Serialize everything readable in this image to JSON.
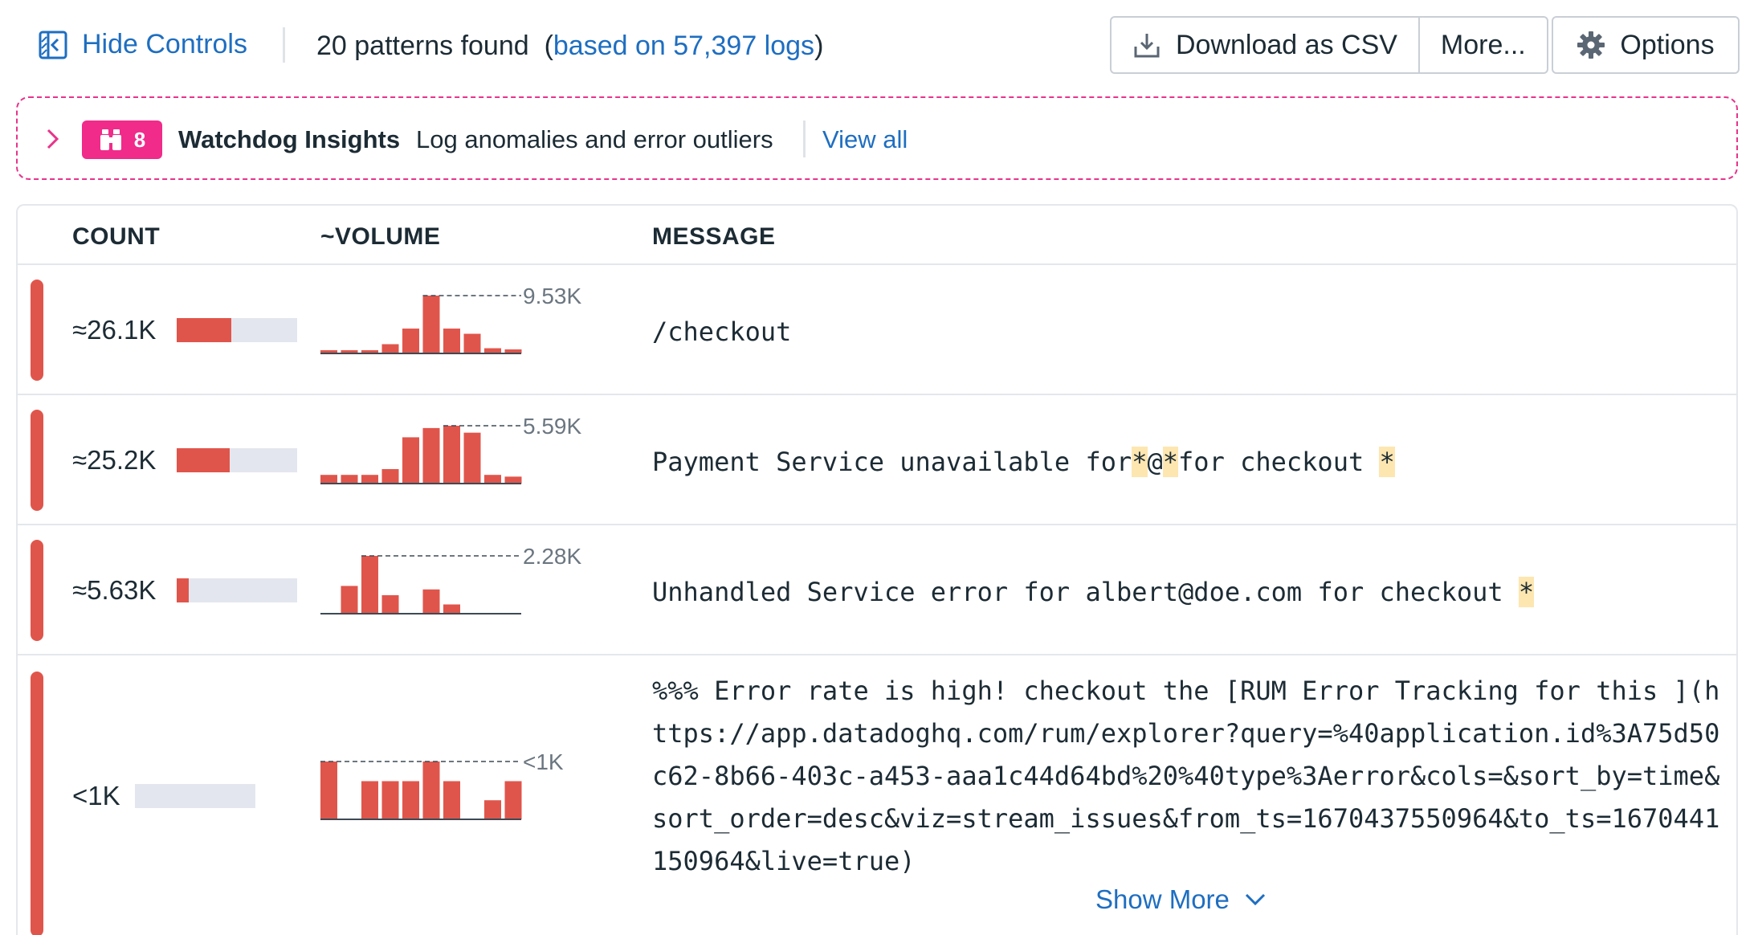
{
  "toolbar": {
    "hide_controls_label": "Hide Controls",
    "patterns_found": "20 patterns found",
    "paren_open": "(",
    "based_on": "based on 57,397 logs",
    "paren_close": ")",
    "download_label": "Download as CSV",
    "more_label": "More...",
    "options_label": "Options"
  },
  "watchdog": {
    "badge_count": "8",
    "title": "Watchdog Insights",
    "subtitle": "Log anomalies and error outliers",
    "view_all": "View all"
  },
  "table": {
    "headers": {
      "count": "COUNT",
      "volume": "~VOLUME",
      "message": "MESSAGE"
    },
    "rows": [
      {
        "count": "≈26.1K",
        "count_fraction": 0.45,
        "volume_max_label": "9.53K",
        "volume_bars": [
          0.05,
          0.05,
          0.05,
          0.16,
          0.43,
          1.0,
          0.43,
          0.34,
          0.09,
          0.07
        ],
        "message_parts": [
          "/checkout"
        ]
      },
      {
        "count": "≈25.2K",
        "count_fraction": 0.44,
        "volume_max_label": "5.59K",
        "volume_bars": [
          0.15,
          0.15,
          0.15,
          0.25,
          0.8,
          0.96,
          1.0,
          0.88,
          0.15,
          0.12
        ],
        "message_parts": [
          "Payment Service unavailable for",
          "*",
          "@",
          "*",
          "for checkout ",
          "*"
        ]
      },
      {
        "count": "≈5.63K",
        "count_fraction": 0.1,
        "volume_max_label": "2.28K",
        "volume_bars": [
          0,
          0.48,
          1.0,
          0.32,
          0,
          0.42,
          0.16,
          0,
          0,
          0
        ],
        "message_parts": [
          "Unhandled Service error for albert@doe.com for checkout ",
          "*"
        ]
      },
      {
        "count": "<1K",
        "count_fraction": 0,
        "volume_max_label": "<1K",
        "volume_bars": [
          1.0,
          0,
          0.66,
          0.66,
          0.66,
          1.0,
          0.66,
          0,
          0.33,
          0.66
        ],
        "message_parts": [
          "%%% Error rate is high! checkout the [RUM Error Tracking for this ](https://app.datadoghq.com/rum/explorer?query=%40application.id%3A75d50c62-8b66-403c-a453-aaa1c44d64bd%20%40type%3Aerror&cols=&sort_by=time&sort_order=desc&viz=stream_issues&from_ts=1670437550964&to_ts=1670441150964&live=true)"
        ]
      }
    ],
    "show_more": "Show More"
  },
  "colors": {
    "link": "#1e6ec1",
    "error": "#e0554b",
    "watchdog_pink": "#f02b8a",
    "highlight": "#fde6b0"
  },
  "icons": [
    "hide-controls-icon",
    "download-icon",
    "gear-icon",
    "chevron-right-icon",
    "binoculars-icon",
    "chevron-down-icon"
  ]
}
